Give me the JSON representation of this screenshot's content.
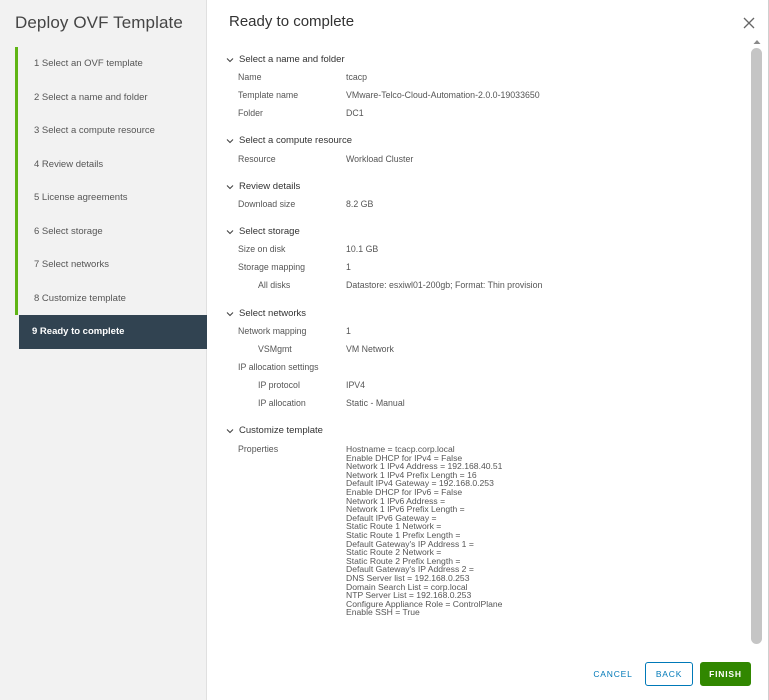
{
  "wizard": {
    "title": "Deploy OVF Template",
    "steps": [
      {
        "label": "1  Select an OVF template"
      },
      {
        "label": "2  Select a name and folder"
      },
      {
        "label": "3  Select a compute resource"
      },
      {
        "label": "4  Review details"
      },
      {
        "label": "5  License agreements"
      },
      {
        "label": "6  Select storage"
      },
      {
        "label": "7  Select networks"
      },
      {
        "label": "8  Customize template"
      },
      {
        "label": "9  Ready to complete"
      }
    ]
  },
  "content": {
    "title": "Ready to complete",
    "name_folder": {
      "header": "Select a name and folder",
      "name_label": "Name",
      "name_value": "tcacp",
      "template_label": "Template name",
      "template_value": "VMware-Telco-Cloud-Automation-2.0.0-19033650",
      "folder_label": "Folder",
      "folder_value": "DC1"
    },
    "compute": {
      "header": "Select a compute resource",
      "resource_label": "Resource",
      "resource_value": "Workload Cluster"
    },
    "review": {
      "header": "Review details",
      "download_label": "Download size",
      "download_value": "8.2 GB"
    },
    "storage": {
      "header": "Select storage",
      "size_label": "Size on disk",
      "size_value": "10.1 GB",
      "mapping_label": "Storage mapping",
      "mapping_value": "1",
      "disks_label": "All disks",
      "disks_value": "Datastore: esxiwl01-200gb; Format: Thin provision"
    },
    "networks": {
      "header": "Select networks",
      "mapping_label": "Network mapping",
      "mapping_value": "1",
      "vsmgmt_label": "VSMgmt",
      "vsmgmt_value": "VM Network",
      "ip_settings_label": "IP allocation settings",
      "ip_protocol_label": "IP protocol",
      "ip_protocol_value": "IPV4",
      "ip_allocation_label": "IP allocation",
      "ip_allocation_value": "Static - Manual"
    },
    "customize": {
      "header": "Customize template",
      "properties_label": "Properties",
      "properties": [
        "Hostname = tcacp.corp.local",
        "Enable DHCP for IPv4 = False",
        "Network 1 IPv4 Address = 192.168.40.51",
        "Network 1 IPv4 Prefix Length = 16",
        "Default IPv4 Gateway = 192.168.0.253",
        "Enable DHCP for IPv6 = False",
        "Network 1 IPv6 Address =",
        "Network 1 IPv6 Prefix Length =",
        "Default IPv6 Gateway =",
        "Static Route 1 Network =",
        "Static Route 1 Prefix Length =",
        "Default Gateway's IP Address 1 =",
        "Static Route 2 Network =",
        "Static Route 2 Prefix Length =",
        "Default Gateway's IP Address 2 =",
        "DNS Server list = 192.168.0.253",
        "Domain Search List = corp.local",
        "NTP Server List = 192.168.0.253",
        "Configure Appliance Role = ControlPlane",
        "Enable SSH = True"
      ]
    }
  },
  "footer": {
    "cancel": "CANCEL",
    "back": "BACK",
    "finish": "FINISH"
  },
  "colors": {
    "step_bar": "#60b515",
    "active_step_bg": "#314351",
    "primary": "#0079b8",
    "finish": "#318700"
  }
}
